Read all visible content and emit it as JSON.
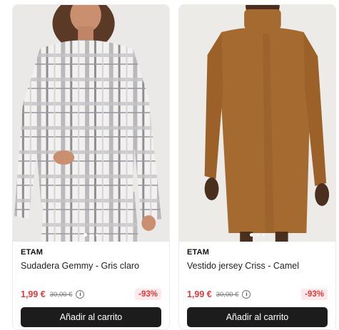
{
  "products": [
    {
      "brand": "ETAM",
      "name": "Sudadera Gemmy - Gris claro",
      "price": "1,99 €",
      "old_price": "30,00 €",
      "discount": "-93%",
      "add_to_cart": "Añadir al carrito",
      "info_glyph": "i",
      "image_icon": "plaid-sweatshirt-photo",
      "carousel": {
        "total": 3,
        "active": 1
      }
    },
    {
      "brand": "ETAM",
      "name": "Vestido jersey Criss - Camel",
      "price": "1,99 €",
      "old_price": "30,00 €",
      "discount": "-93%",
      "add_to_cart": "Añadir al carrito",
      "info_glyph": "i",
      "image_icon": "camel-sweater-dress-photo",
      "carousel": {
        "total": 3,
        "active": 1
      }
    }
  ],
  "colors": {
    "price_red": "#e5383b",
    "discount_bg": "#fde9ea",
    "button_bg": "#1c1c1c",
    "button_text": "#ffffff",
    "dress_camel": "#a46a30"
  }
}
